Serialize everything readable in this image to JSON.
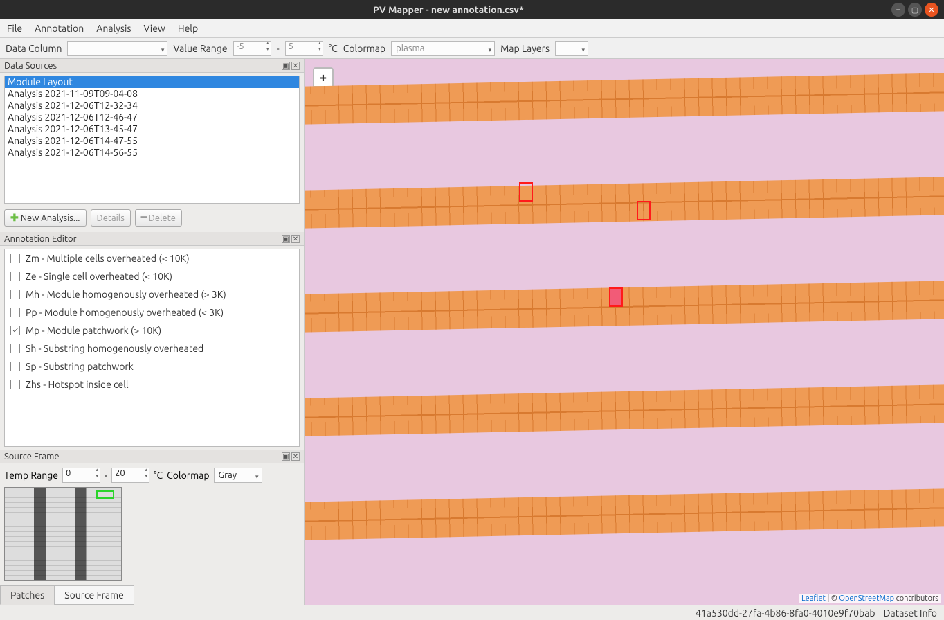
{
  "window": {
    "title": "PV Mapper - new annotation.csv*"
  },
  "menu": [
    "File",
    "Annotation",
    "Analysis",
    "View",
    "Help"
  ],
  "toolbar": {
    "dataColumn": "Data Column",
    "valueRange": "Value Range",
    "vr_min": "-5",
    "vr_dash": "-",
    "vr_max": "5",
    "unit": "°C",
    "colormap": "Colormap",
    "colormap_val": "plasma",
    "mapLayers": "Map Layers"
  },
  "dataSources": {
    "title": "Data Sources",
    "items": [
      "Module Layout",
      "Analysis 2021-11-09T09-04-08",
      "Analysis 2021-12-06T12-32-34",
      "Analysis 2021-12-06T12-46-47",
      "Analysis 2021-12-06T13-45-47",
      "Analysis 2021-12-06T14-47-55",
      "Analysis 2021-12-06T14-56-55"
    ],
    "newAnalysis": "New Analysis...",
    "details": "Details",
    "delete": "Delete"
  },
  "annEditor": {
    "title": "Annotation Editor",
    "items": [
      {
        "chk": false,
        "label": "Zm - Multiple cells overheated (< 10K)"
      },
      {
        "chk": false,
        "label": "Ze - Single cell overheated (< 10K)"
      },
      {
        "chk": false,
        "label": "Mh - Module homogenously overheated (> 3K)"
      },
      {
        "chk": false,
        "label": "Pp - Module homogenously overheated (< 3K)"
      },
      {
        "chk": true,
        "label": "Mp - Module patchwork (> 10K)"
      },
      {
        "chk": false,
        "label": "Sh - Substring homogenously overheated"
      },
      {
        "chk": false,
        "label": "Sp - Substring patchwork"
      },
      {
        "chk": false,
        "label": "Zhs - Hotspot inside cell"
      }
    ]
  },
  "sourceFrame": {
    "title": "Source Frame",
    "tempRange": "Temp Range",
    "tmin": "0",
    "dash": "-",
    "tmax": "20",
    "unit": "°C",
    "colormap": "Colormap",
    "colormap_val": "Gray"
  },
  "tabs": {
    "patches": "Patches",
    "sourceFrame": "Source Frame"
  },
  "map": {
    "leaflet": "Leaflet",
    "sep": " | © ",
    "osm": "OpenStreetMap",
    "tail": " contributors"
  },
  "status": {
    "id": "41a530dd-27fa-4b86-8fa0-4010e9f70bab",
    "label": "Dataset Info"
  }
}
